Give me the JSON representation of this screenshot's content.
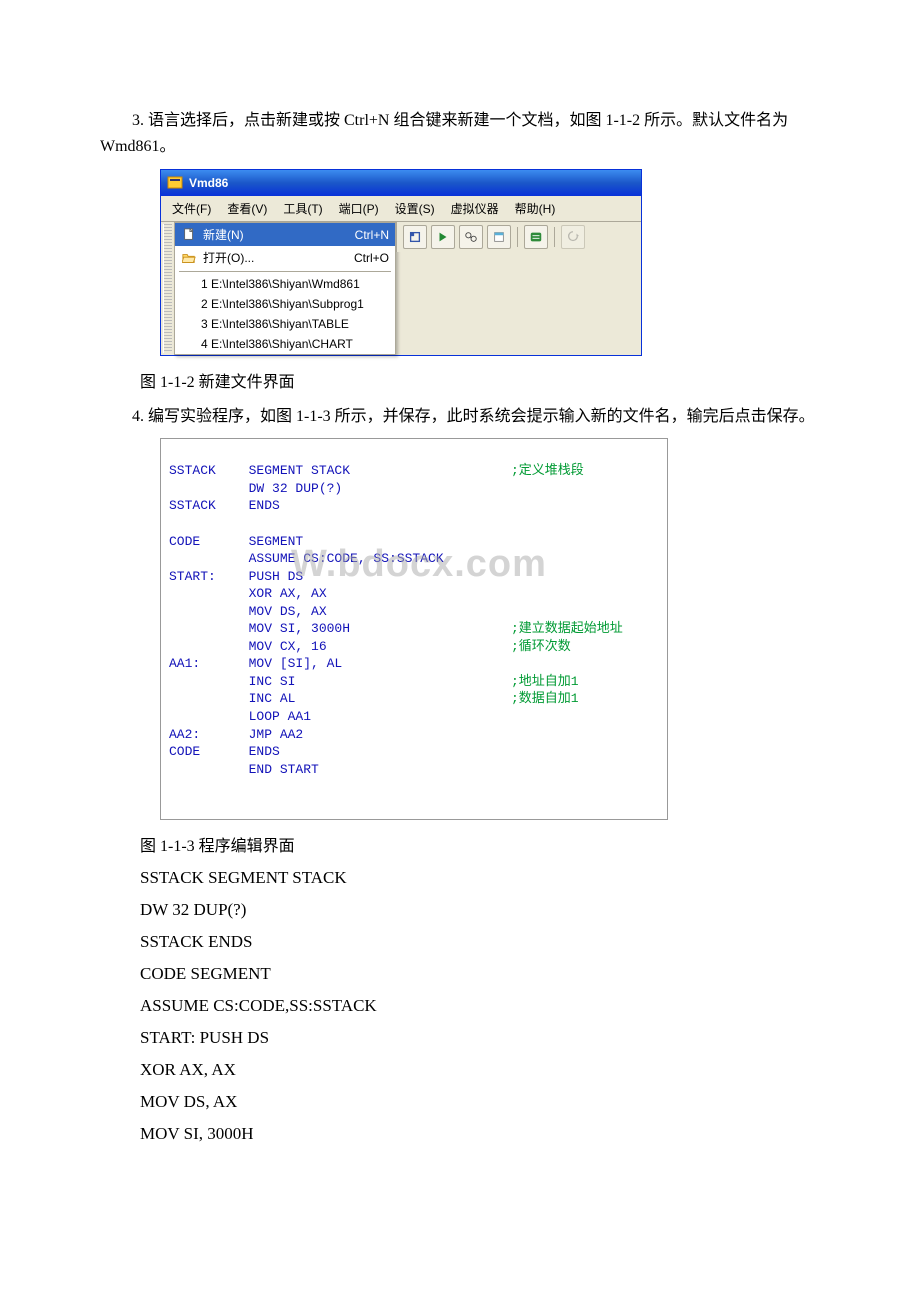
{
  "para1": "3. 语言选择后，点击新建或按 Ctrl+N 组合键来新建一个文档，如图 1-1-2 所示。默认文件名为 Wmd861。",
  "para2": "4. 编写实验程序，如图 1-1-3 所示，并保存，此时系统会提示输入新的文件名，输完后点击保存。",
  "caption1": "图 1-1-2 新建文件界面",
  "caption2": "图 1-1-3 程序编辑界面",
  "window": {
    "title": "Vmd86",
    "menu": {
      "file": "文件(F)",
      "view": "查看(V)",
      "tool": "工具(T)",
      "port": "端口(P)",
      "settings": "设置(S)",
      "virtual": "虚拟仪器",
      "help": "帮助(H)"
    },
    "file_menu": {
      "new_label": "新建(N)",
      "new_shortcut": "Ctrl+N",
      "open_label": "打开(O)...",
      "open_shortcut": "Ctrl+O",
      "mru1": "1 E:\\Intel386\\Shiyan\\Wmd861",
      "mru2": "2 E:\\Intel386\\Shiyan\\Subprog1",
      "mru3": "3 E:\\Intel386\\Shiyan\\TABLE",
      "mru4": "4 E:\\Intel386\\Shiyan\\CHART"
    }
  },
  "editor": {
    "l1a": "SSTACK",
    "l1b": "SEGMENT STACK",
    "l1c": ";定义堆栈段",
    "l2b": "DW 32 DUP(?)",
    "l3a": "SSTACK",
    "l3b": "ENDS",
    "l5a": "CODE",
    "l5b": "SEGMENT",
    "l6b": "ASSUME CS:CODE, SS:SSTACK",
    "l7a": "START:",
    "l7b": "PUSH DS",
    "l8b": "XOR AX, AX",
    "l9b": "MOV DS, AX",
    "l10b": "MOV SI, 3000H",
    "l10c": ";建立数据起始地址",
    "l11b": "MOV CX, 16",
    "l11c": ";循环次数",
    "l12a": "AA1:",
    "l12b": "MOV [SI], AL",
    "l13b": "INC SI",
    "l13c": ";地址自加1",
    "l14b": "INC AL",
    "l14c": ";数据自加1",
    "l15b": "LOOP AA1",
    "l16a": "AA2:",
    "l16b": "JMP AA2",
    "l17a": "CODE",
    "l17b": "ENDS",
    "l18b": "END START",
    "watermark": "W.bdocx.com"
  },
  "asm": {
    "l1": "SSTACK SEGMENT STACK",
    "l2": " DW 32 DUP(?)",
    "l3": "SSTACK ENDS",
    "l4": "CODE SEGMENT",
    "l5": " ASSUME CS:CODE,SS:SSTACK",
    "l6": "START: PUSH DS",
    "l7": " XOR AX, AX",
    "l8": " MOV DS, AX",
    "l9": " MOV SI, 3000H"
  }
}
